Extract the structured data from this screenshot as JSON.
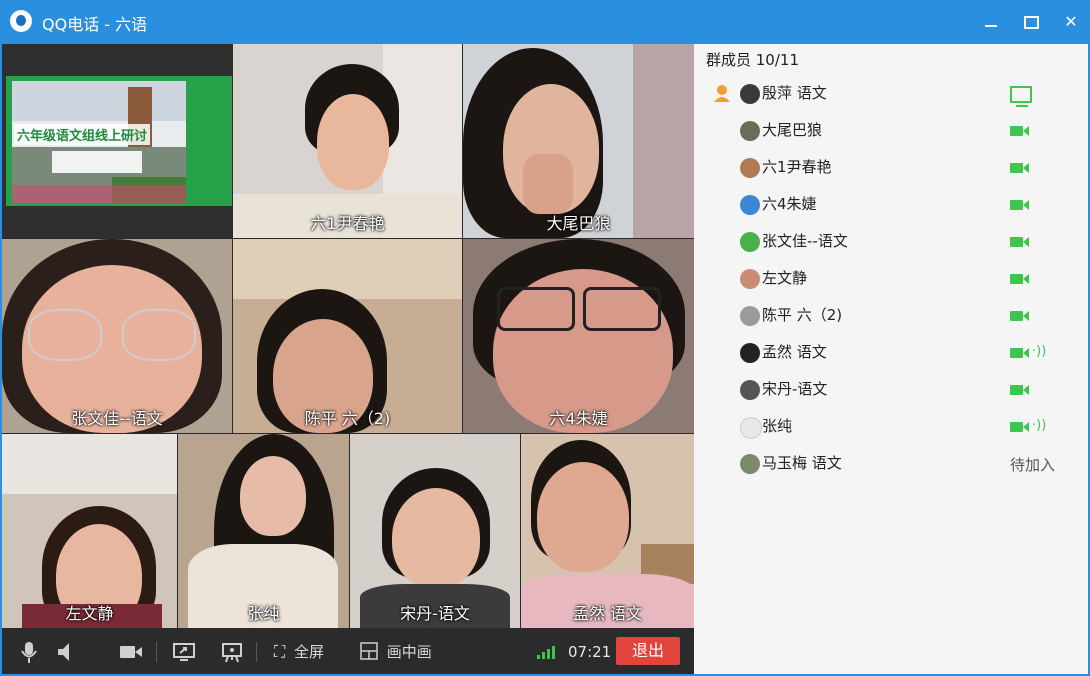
{
  "window": {
    "title": "QQ电话 - 六语"
  },
  "video_tiles": [
    {
      "label": "六1尹春艳"
    },
    {
      "label": "大尾巴狼"
    },
    {
      "label": "张文佳--语文"
    },
    {
      "label": "陈平 六（2)"
    },
    {
      "label": "六4朱婕"
    },
    {
      "label": "左文静"
    },
    {
      "label": "张纯"
    },
    {
      "label": "宋丹-语文"
    },
    {
      "label": "孟然 语文"
    }
  ],
  "shared_screen": {
    "title": "六年级语文组线上研讨"
  },
  "controls": {
    "fullscreen_label": "全屏",
    "pip_label": "画中画",
    "time": "07:21",
    "exit_label": "退出"
  },
  "members_panel": {
    "header": "群成员 10/11",
    "members": [
      {
        "name": "殷萍 语文",
        "status": "sharing"
      },
      {
        "name": "大尾巴狼",
        "status": "video"
      },
      {
        "name": "六1尹春艳",
        "status": "video"
      },
      {
        "name": "六4朱婕",
        "status": "video"
      },
      {
        "name": "张文佳--语文",
        "status": "video"
      },
      {
        "name": "左文静",
        "status": "video"
      },
      {
        "name": "陈平 六（2)",
        "status": "video"
      },
      {
        "name": "孟然 语文",
        "status": "video-speaking"
      },
      {
        "name": "宋丹-语文",
        "status": "video"
      },
      {
        "name": "张纯",
        "status": "video-speaking"
      },
      {
        "name": "马玉梅 语文",
        "status": "waiting",
        "status_text": "待加入"
      }
    ]
  },
  "colors": {
    "titlebar": "#2b8fe0",
    "accent_green": "#3ec54e",
    "exit_red": "#e0443c",
    "controls_bg": "#2b2b2b"
  }
}
